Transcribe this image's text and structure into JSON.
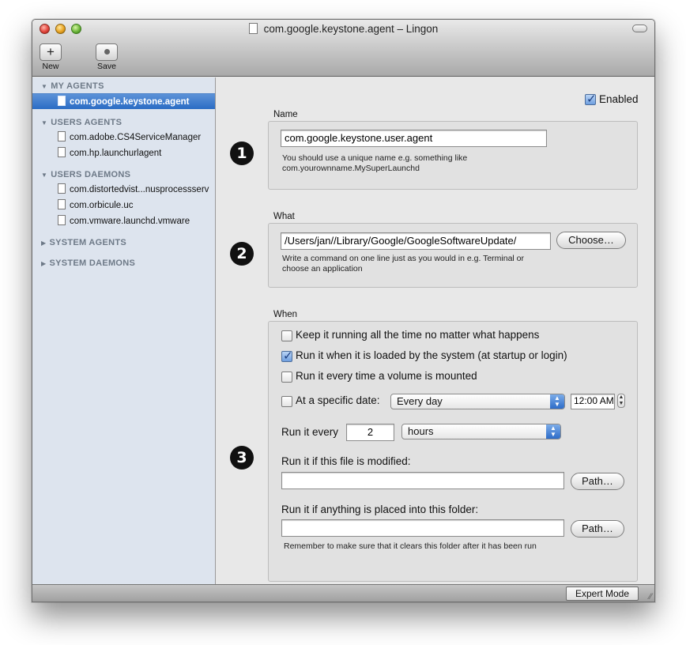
{
  "window": {
    "title": "com.google.keystone.agent – Lingon"
  },
  "toolbar": {
    "new_label": "New",
    "new_glyph": "+",
    "save_label": "Save"
  },
  "sidebar": {
    "groups": [
      {
        "label": "MY AGENTS",
        "expanded": true,
        "items": [
          "com.google.keystone.agent"
        ]
      },
      {
        "label": "USERS AGENTS",
        "expanded": true,
        "items": [
          "com.adobe.CS4ServiceManager",
          "com.hp.launchurlagent"
        ]
      },
      {
        "label": "USERS DAEMONS",
        "expanded": true,
        "items": [
          "com.distortedvist...nusprocessserv",
          "com.orbicule.uc",
          "com.vmware.launchd.vmware"
        ]
      },
      {
        "label": "SYSTEM AGENTS",
        "expanded": false,
        "items": []
      },
      {
        "label": "SYSTEM DAEMONS",
        "expanded": false,
        "items": []
      }
    ],
    "selected": "com.google.keystone.agent"
  },
  "main": {
    "enabled_label": "Enabled",
    "enabled_checked": true,
    "step1": {
      "number": "1",
      "label": "Name",
      "value": "com.google.keystone.user.agent",
      "hint_line1": "You should use a unique name e.g. something like",
      "hint_line2": "com.yourownname.MySuperLaunchd"
    },
    "step2": {
      "number": "2",
      "label": "What",
      "value": "/Users/jan//Library/Google/GoogleSoftwareUpdate/",
      "choose_label": "Choose…",
      "hint_line1": "Write a command on one line just as you would in e.g. Terminal or",
      "hint_line2": "choose an application"
    },
    "step3": {
      "number": "3",
      "label": "When",
      "options": [
        {
          "label": "Keep it running all the time no matter what happens",
          "checked": false
        },
        {
          "label": "Run it when it is loaded by the system (at startup or login)",
          "checked": true
        },
        {
          "label": "Run it every time a volume is mounted",
          "checked": false
        }
      ],
      "specific_date_label": "At a specific date:",
      "specific_date_checked": false,
      "date_value": "Every day",
      "time_value": "12:00 AM",
      "run_every_label": "Run it every",
      "run_every_value": "2",
      "run_every_unit": "hours",
      "file_modified_label": "Run it if this file is modified:",
      "file_modified_value": "",
      "folder_label": "Run it if anything is placed into this folder:",
      "folder_value": "",
      "path_label": "Path…",
      "folder_hint": "Remember to make sure that it clears this folder after it has been run"
    }
  },
  "bottombar": {
    "expert_label": "Expert Mode"
  },
  "colors": {
    "selection": "#2a6cc4",
    "sidebar_bg": "#dde4ee",
    "accent_checkbox": "#6f9fdf"
  },
  "icons": [
    "document-icon",
    "plus-icon",
    "save-dot-icon",
    "disclosure-triangle-icon",
    "checkmark-icon",
    "popup-arrows-icon",
    "resize-grip-icon"
  ]
}
